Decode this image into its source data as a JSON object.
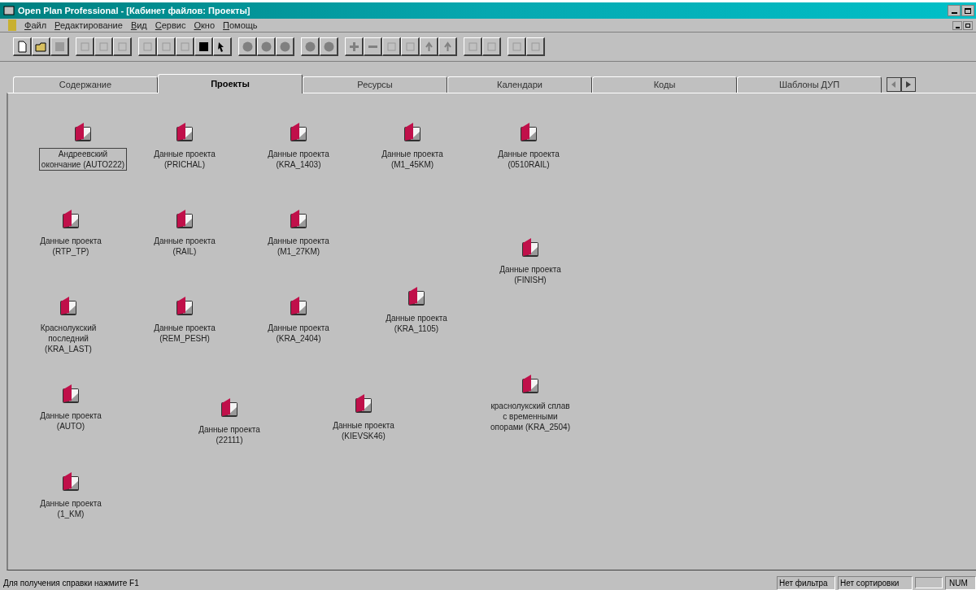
{
  "window": {
    "title": "Open Plan Professional - [Кабинет файлов: Проекты]"
  },
  "menu": [
    "Файл",
    "Редактирование",
    "Вид",
    "Сервис",
    "Окно",
    "Помощь"
  ],
  "tabs": [
    {
      "label": "Содержание",
      "selected": false
    },
    {
      "label": "Проекты",
      "selected": true
    },
    {
      "label": "Ресурсы",
      "selected": false
    },
    {
      "label": "Календари",
      "selected": false
    },
    {
      "label": "Коды",
      "selected": false
    },
    {
      "label": "Шаблоны ДУП",
      "selected": false
    }
  ],
  "projects": [
    {
      "lines": [
        "Андреевский",
        "окончание (AUTO222)"
      ],
      "selected": true
    },
    {
      "lines": [
        "Данные проекта",
        "(PRICHAL)"
      ],
      "selected": false
    },
    {
      "lines": [
        "Данные проекта",
        "(KRA_1403)"
      ],
      "selected": false
    },
    {
      "lines": [
        "Данные проекта",
        "(M1_45KM)"
      ],
      "selected": false
    },
    {
      "lines": [
        "Данные проекта",
        "(0510RAIL)"
      ],
      "selected": false
    },
    {
      "lines": [
        "Данные проекта",
        "(RTP_TP)"
      ],
      "selected": false
    },
    {
      "lines": [
        "Данные проекта",
        "(RAIL)"
      ],
      "selected": false
    },
    {
      "lines": [
        "Данные проекта",
        "(M1_27KM)"
      ],
      "selected": false
    },
    {
      "lines": [
        "Данные проекта",
        "(FINISH)"
      ],
      "selected": false
    },
    {
      "lines": [
        "Краснолукский",
        "последний",
        "(KRA_LAST)"
      ],
      "selected": false
    },
    {
      "lines": [
        "Данные проекта",
        "(REM_PESH)"
      ],
      "selected": false
    },
    {
      "lines": [
        "Данные проекта",
        "(KRA_2404)"
      ],
      "selected": false
    },
    {
      "lines": [
        "Данные проекта",
        "(KRA_1105)"
      ],
      "selected": false
    },
    {
      "lines": [
        "Данные проекта",
        "(AUTO)"
      ],
      "selected": false
    },
    {
      "lines": [
        "Данные проекта",
        "(22111)"
      ],
      "selected": false
    },
    {
      "lines": [
        "Данные проекта",
        "(KIEVSK46)"
      ],
      "selected": false
    },
    {
      "lines": [
        "краснолукский сплав",
        "с временными",
        "опорами (KRA_2504)"
      ],
      "selected": false
    },
    {
      "lines": [
        "Данные проекта",
        "(1_KM)"
      ],
      "selected": false
    }
  ],
  "status_bar": {
    "help": "Для получения справки нажмите F1",
    "filter": "Нет фильтра",
    "sort": "Нет сортировки",
    "indicator": "NUM"
  }
}
